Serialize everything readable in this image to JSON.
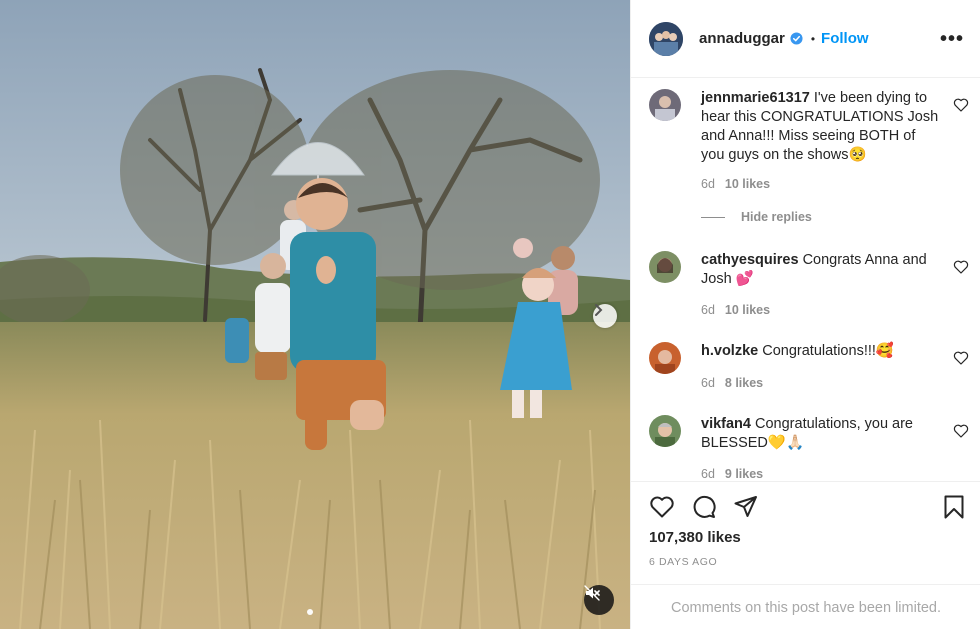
{
  "post": {
    "username": "annaduggar",
    "follow_label": "Follow",
    "separator": "•",
    "more_label": "•••",
    "likes_count": "107,380 likes",
    "time_ago": "6 DAYS AGO",
    "comments_limited": "Comments on this post have been limited."
  },
  "comments": [
    {
      "username": "jennmarie61317",
      "text": "I've been dying to hear this CONGRATULATIONS Josh and Anna!!! Miss seeing BOTH of you guys on the shows🥺",
      "age": "6d",
      "likes": "10 likes"
    },
    {
      "username": "cathyesquires",
      "text": "Congrats Anna and Josh 💕",
      "age": "6d",
      "likes": "10 likes"
    },
    {
      "username": "h.volzke",
      "text": "Congratulations!!!🥰",
      "age": "6d",
      "likes": "8 likes"
    },
    {
      "username": "vikfan4",
      "text": "Congratulations, you are BLESSED💛🙏🏻",
      "age": "6d",
      "likes": "9 likes"
    }
  ],
  "hide_replies_label": "Hide replies",
  "icons": {
    "verified": "verified-badge-icon",
    "heart": "heart-icon",
    "comment": "comment-icon",
    "share": "send-icon",
    "save": "bookmark-icon",
    "next": "chevron-right-icon",
    "mute": "speaker-muted-icon"
  },
  "colors": {
    "accent": "#0095f6",
    "muted_text": "#8e8e8e",
    "verified": "#3897f0"
  }
}
